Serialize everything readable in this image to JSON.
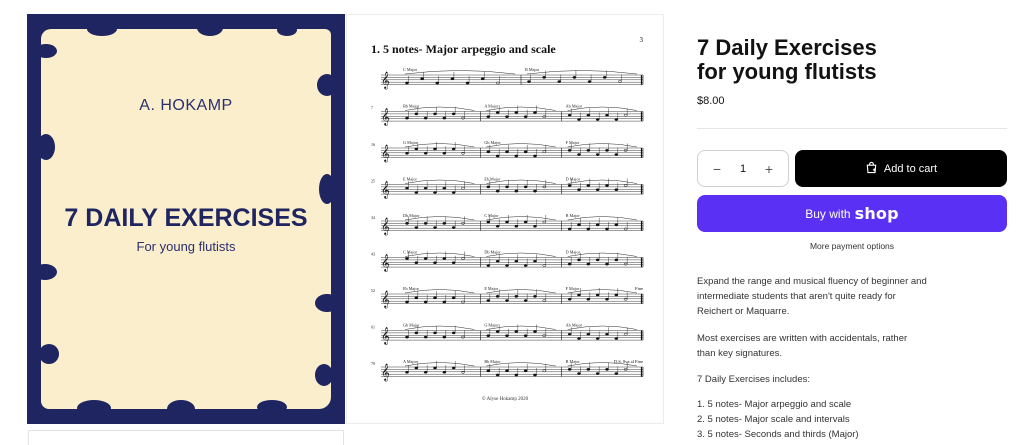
{
  "cover": {
    "author": "A. HOKAMP",
    "title": "7 DAILY EXERCISES",
    "subtitle": "For young flutists",
    "colors": {
      "background": "#fbeecd",
      "frame": "#1e2560"
    }
  },
  "sheet": {
    "heading": "1. 5 notes- Major arpeggio and scale",
    "page_number": "3",
    "copyright": "© Alyse Hokamp 2020",
    "systems": [
      {
        "number": "",
        "keys": [
          "C Major",
          "B Major"
        ]
      },
      {
        "number": "7",
        "keys": [
          "Bb Major",
          "A Major",
          "Ab Major"
        ]
      },
      {
        "number": "16",
        "keys": [
          "G Major",
          "Gb Major",
          "F Major"
        ]
      },
      {
        "number": "25",
        "keys": [
          "E Major",
          "Eb Major",
          "D Major"
        ]
      },
      {
        "number": "34",
        "keys": [
          "Db Major",
          "C Major",
          "B Major"
        ]
      },
      {
        "number": "43",
        "keys": [
          "C Major",
          "Db Major",
          "D Major"
        ]
      },
      {
        "number": "52",
        "keys": [
          "Eb Major",
          "E Major",
          "F Major"
        ],
        "end_mark": "Fine"
      },
      {
        "number": "61",
        "keys": [
          "Gb Major",
          "G Major",
          "Ab Major"
        ]
      },
      {
        "number": "70",
        "keys": [
          "A Major",
          "Bb Major",
          "B Major"
        ],
        "end_mark": "D.S. 8va al Fine"
      }
    ]
  },
  "product": {
    "title_line1": "7 Daily Exercises",
    "title_line2": "for young flutists",
    "price": "$8.00",
    "quantity": "1",
    "minus": "−",
    "plus": "+",
    "add_to_cart": "Add to cart",
    "buy_with": "Buy with",
    "shop_logo": "shop",
    "more_payment": "More payment options",
    "description": [
      "Expand the range and musical fluency of beginner and intermediate students that aren't quite ready for Reichert or Maquarre.",
      "Most exercises are written with accidentals, rather than key signatures.",
      "7 Daily Exercises includes:"
    ],
    "includes": [
      "1. 5 notes- Major arpeggio and scale",
      "2. 5 notes- Major scale and intervals",
      "3. 5 notes- Seconds and thirds (Major)"
    ],
    "colors": {
      "add_to_cart": "#000000",
      "buy_button": "#5a31f4"
    },
    "icons": {
      "cart": "cart-icon"
    }
  }
}
